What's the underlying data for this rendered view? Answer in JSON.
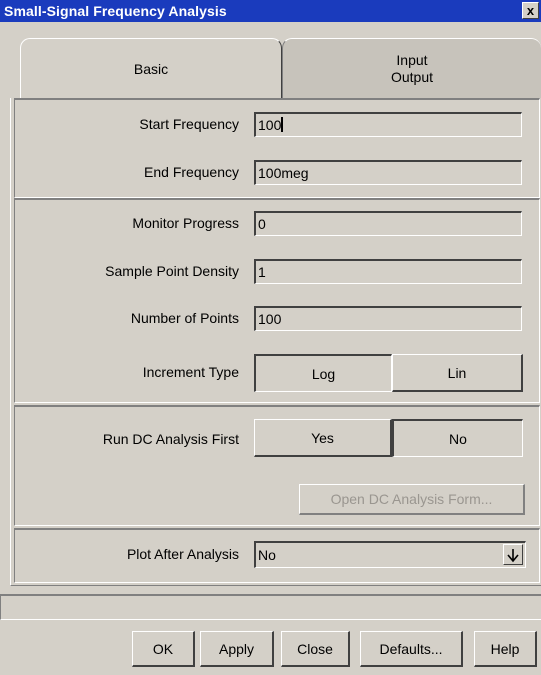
{
  "window": {
    "title": "Small-Signal Frequency Analysis",
    "close_glyph": "x"
  },
  "tabs": {
    "basic": "Basic",
    "io_line1": "Input",
    "io_line2": "Output"
  },
  "frequency": {
    "start_label": "Start Frequency",
    "start_value": "100",
    "end_label": "End Frequency",
    "end_value": "100meg"
  },
  "sampling": {
    "monitor_label": "Monitor Progress",
    "monitor_value": "0",
    "density_label": "Sample Point Density",
    "density_value": "1",
    "points_label": "Number of Points",
    "points_value": "100",
    "increment_label": "Increment Type",
    "increment_log": "Log",
    "increment_lin": "Lin",
    "increment_selected": "Log"
  },
  "dc": {
    "run_label": "Run DC Analysis First",
    "yes": "Yes",
    "no": "No",
    "selected": "Yes",
    "open_form": "Open DC Analysis Form..."
  },
  "plot": {
    "label": "Plot After Analysis",
    "value": "No"
  },
  "buttons": {
    "ok": "OK",
    "apply": "Apply",
    "close": "Close",
    "defaults": "Defaults...",
    "help": "Help"
  }
}
